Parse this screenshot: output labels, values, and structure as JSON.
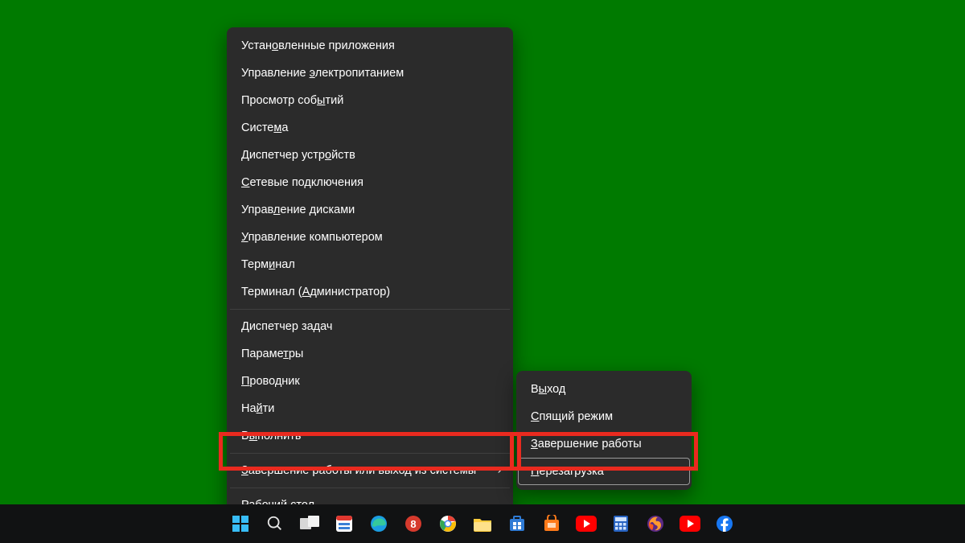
{
  "mainMenu": {
    "groups": [
      [
        {
          "pre": "Устан",
          "u": "о",
          "post": "вленные приложения"
        },
        {
          "pre": "Управление ",
          "u": "э",
          "post": "лектропитанием"
        },
        {
          "pre": "Просмотр соб",
          "u": "ы",
          "post": "тий"
        },
        {
          "pre": "Систе",
          "u": "м",
          "post": "а"
        },
        {
          "pre": "Диспетчер устр",
          "u": "о",
          "post": "йств"
        },
        {
          "pre": "",
          "u": "С",
          "post": "етевые подключения"
        },
        {
          "pre": "Управ",
          "u": "л",
          "post": "ение дисками"
        },
        {
          "pre": "",
          "u": "У",
          "post": "правление компьютером"
        },
        {
          "pre": "Терм",
          "u": "и",
          "post": "нал"
        },
        {
          "pre": "Терминал (",
          "u": "А",
          "post": "дминистратор)"
        }
      ],
      [
        {
          "pre": "",
          "u": "Д",
          "post": "испетчер задач"
        },
        {
          "pre": "Параме",
          "u": "т",
          "post": "ры"
        },
        {
          "pre": "",
          "u": "П",
          "post": "роводник"
        },
        {
          "pre": "На",
          "u": "й",
          "post": "ти"
        },
        {
          "pre": "В",
          "u": "ы",
          "post": "полнить"
        }
      ],
      [
        {
          "pre": "",
          "u": "З",
          "post": "авершение работы или выход из системы",
          "submenu": true
        }
      ],
      [
        {
          "pre": "",
          "u": "Р",
          "post": "абочий стол"
        }
      ]
    ]
  },
  "subMenu": {
    "items": [
      {
        "pre": "В",
        "u": "ы",
        "post": "ход"
      },
      {
        "pre": "",
        "u": "С",
        "post": "пящий режим"
      },
      {
        "pre": "",
        "u": "З",
        "post": "авершение работы"
      },
      {
        "pre": "",
        "u": "П",
        "post": "ерезагрузка",
        "selected": true
      }
    ]
  },
  "taskbar": {
    "items": [
      {
        "id": "start",
        "title": "Start"
      },
      {
        "id": "search",
        "title": "Search"
      },
      {
        "id": "taskview",
        "title": "Task View"
      },
      {
        "id": "snip",
        "title": "Snipping Tool"
      },
      {
        "id": "edge",
        "title": "Microsoft Edge"
      },
      {
        "id": "app-red",
        "title": "App"
      },
      {
        "id": "chrome",
        "title": "Google Chrome"
      },
      {
        "id": "explorer",
        "title": "File Explorer"
      },
      {
        "id": "store",
        "title": "Microsoft Store"
      },
      {
        "id": "app-shop",
        "title": "App"
      },
      {
        "id": "youtube1",
        "title": "YouTube"
      },
      {
        "id": "calc",
        "title": "Calculator"
      },
      {
        "id": "firefox",
        "title": "Firefox"
      },
      {
        "id": "youtube2",
        "title": "YouTube"
      },
      {
        "id": "facebook",
        "title": "Facebook"
      }
    ]
  }
}
